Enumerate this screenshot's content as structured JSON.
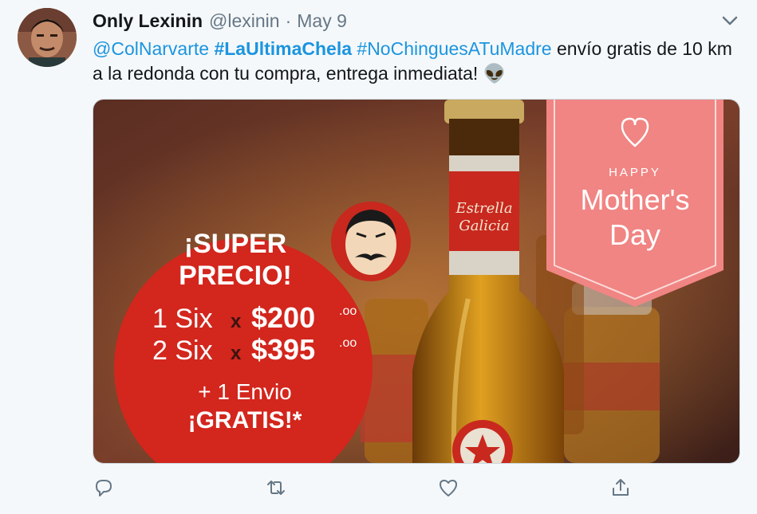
{
  "tweet": {
    "author_name": "Only Lexinin",
    "author_handle": "@lexinin",
    "separator": "·",
    "date": "May 9",
    "text": {
      "mention": "@ColNarvarte",
      "hashtag1": "#LaUltimaChela",
      "hashtag2": "#NoChinguesATuMadre",
      "body": "envío gratis de 10 km a la redonda con tu compra, entrega inmediata!",
      "emoji": "👽"
    }
  },
  "image": {
    "ad_line1": "¡SUPER",
    "ad_line2": "PRECIO!",
    "price1_qty": "1 Six",
    "price1_x": "x",
    "price1_amount": "$200",
    "price1_cents": ".oo",
    "price2_qty": "2 Six",
    "price2_x": "x",
    "price2_amount": "$395",
    "price2_cents": ".oo",
    "envio_line": "+ 1 Envio",
    "gratis_line": "¡GRATIS!*",
    "ribbon_happy": "HAPPY",
    "ribbon_mothers": "Mother's",
    "ribbon_day": "Day",
    "label_brand_line1": "Estrella",
    "label_brand_line2": "Galicia"
  },
  "actions": {
    "reply_icon": "reply-icon",
    "retweet_icon": "retweet-icon",
    "like_icon": "heart-icon",
    "share_icon": "share-icon"
  },
  "colors": {
    "link": "#1b95e0",
    "secondary": "#657786",
    "ad_red": "#d3261d",
    "ribbon_pink": "#f08583"
  }
}
